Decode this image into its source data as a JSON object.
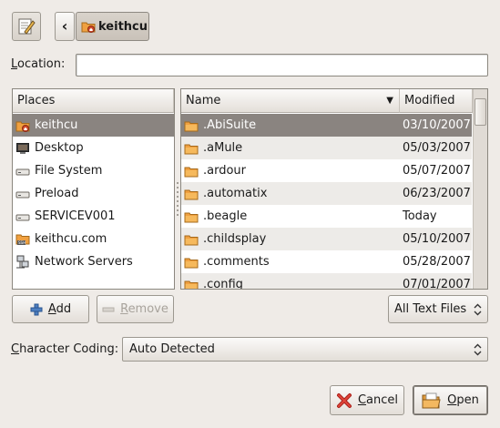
{
  "toolbar": {
    "back_glyph": "‹",
    "path_button": "keithcu"
  },
  "location": {
    "label_first": "L",
    "label_rest": "ocation:",
    "value": ""
  },
  "places": {
    "header": "Places",
    "items": [
      {
        "label": "keithcu",
        "icon": "home-folder-icon",
        "selected": true
      },
      {
        "label": "Desktop",
        "icon": "desktop-icon"
      },
      {
        "label": "File System",
        "icon": "drive-icon"
      },
      {
        "label": "Preload",
        "icon": "drive-icon"
      },
      {
        "label": "SERVICEV001",
        "icon": "drive-icon"
      },
      {
        "label": "keithcu.com",
        "icon": "network-share-icon"
      },
      {
        "label": "Network Servers",
        "icon": "network-icon"
      }
    ]
  },
  "files": {
    "columns": {
      "name": "Name",
      "modified": "Modified"
    },
    "rows": [
      {
        "name": ".AbiSuite",
        "modified": "03/10/2007",
        "selected": true
      },
      {
        "name": ".aMule",
        "modified": "05/03/2007"
      },
      {
        "name": ".ardour",
        "modified": "05/07/2007"
      },
      {
        "name": ".automatix",
        "modified": "06/23/2007"
      },
      {
        "name": ".beagle",
        "modified": "Today"
      },
      {
        "name": ".childsplay",
        "modified": "05/10/2007"
      },
      {
        "name": ".comments",
        "modified": "05/28/2007"
      },
      {
        "name": ".config",
        "modified": "07/01/2007"
      }
    ]
  },
  "buttons": {
    "add_first": "A",
    "add_rest": "dd",
    "remove_first": "R",
    "remove_rest": "emove",
    "cancel_first": "C",
    "cancel_rest": "ancel",
    "open_first": "O",
    "open_rest": "pen"
  },
  "filter": {
    "selected": "All Text Files"
  },
  "coding": {
    "label_first": "C",
    "label_rest": "haracter Coding:",
    "selected": "Auto Detected"
  },
  "colors": {
    "selection": "#8a8480",
    "folder": "#f0a040",
    "window_bg": "#efebe7"
  }
}
